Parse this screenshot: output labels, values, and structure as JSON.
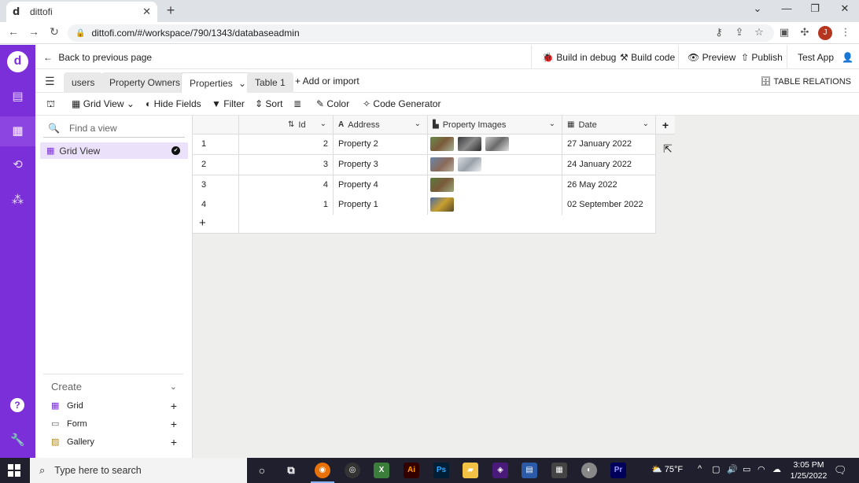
{
  "browser": {
    "tab_title": "dittofi",
    "tab_favicon": "d",
    "url": "dittofi.com/#/workspace/790/1343/databaseadmin",
    "profile_initial": "J"
  },
  "app": {
    "brand_color": "#7b2fd9",
    "logo_letter": "d",
    "back_label": "Back to previous page",
    "actions": {
      "build_debug": "Build in debug",
      "build_code": "Build code",
      "preview": "Preview",
      "publish": "Publish",
      "app_name": "Test App"
    }
  },
  "tables": {
    "tabs": [
      "users",
      "Property Owners",
      "Properties",
      "Table 1"
    ],
    "active_index": 2,
    "add_import": "+ Add or import",
    "relations": "TABLE RELATIONS"
  },
  "toolbar": {
    "grid_view": "Grid View",
    "hide_fields": "Hide Fields",
    "filter": "Filter",
    "sort": "Sort",
    "color": "Color",
    "code_generator": "Code Generator"
  },
  "sidebar": {
    "find_placeholder": "Find a view",
    "views": [
      "Grid View"
    ],
    "create_label": "Create",
    "create_items": [
      "Grid",
      "Form",
      "Gallery"
    ]
  },
  "grid": {
    "columns": [
      "Id",
      "Address",
      "Property Images",
      "Date"
    ],
    "rows": [
      {
        "index": "1",
        "id": "2",
        "address": "Property 2",
        "images": 3,
        "date": "27 January 2022"
      },
      {
        "index": "2",
        "id": "3",
        "address": "Property 3",
        "images": 2,
        "date": "24 January 2022"
      },
      {
        "index": "3",
        "id": "4",
        "address": "Property 4",
        "images": 1,
        "date": "26 May 2022"
      },
      {
        "index": "4",
        "id": "1",
        "address": "Property 1",
        "images": 1,
        "date": "02 September 2022"
      }
    ]
  },
  "taskbar": {
    "search_placeholder": "Type here to search",
    "weather": "75°F",
    "time": "3:05 PM",
    "date": "1/25/2022"
  }
}
